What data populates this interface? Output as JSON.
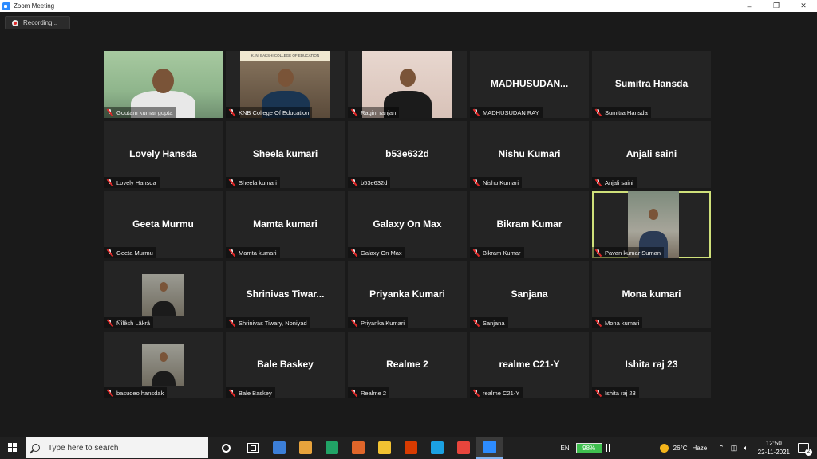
{
  "window": {
    "title": "Zoom Meeting",
    "minimize": "–",
    "maximize": "❐",
    "close": "✕"
  },
  "recording": {
    "label": "Recording..."
  },
  "participants": [
    {
      "big": "",
      "footer": "Goutam kumar gupta",
      "video": "v1"
    },
    {
      "big": "",
      "footer": "KNB College Of Education",
      "video": "v2",
      "banner": "K. N. BAKSHI COLLEGE OF EDUCATION"
    },
    {
      "big": "",
      "footer": "Ragini ranjan",
      "video": "v3"
    },
    {
      "big": "MADHUSUDAN...",
      "footer": "MADHUSUDAN RAY"
    },
    {
      "big": "Sumitra Hansda",
      "footer": "Sumitra Hansda"
    },
    {
      "big": "Lovely Hansda",
      "footer": "Lovely Hansda"
    },
    {
      "big": "Sheela kumari",
      "footer": "Sheela kumari"
    },
    {
      "big": "b53e632d",
      "footer": "b53e632d"
    },
    {
      "big": "Nishu Kumari",
      "footer": "Nishu Kumari"
    },
    {
      "big": "Anjali saini",
      "footer": "Anjali saini"
    },
    {
      "big": "Geeta Murmu",
      "footer": "Geeta Murmu"
    },
    {
      "big": "Mamta kumari",
      "footer": "Mamta kumari"
    },
    {
      "big": "Galaxy On Max",
      "footer": "Galaxy On Max"
    },
    {
      "big": "Bikram Kumar",
      "footer": "Bikram Kumar"
    },
    {
      "big": "",
      "footer": "Pavan kumar Suman",
      "video": "v4",
      "active": true
    },
    {
      "big": "",
      "footer": "Ñîlêsh Lâkrâ",
      "video": "v5"
    },
    {
      "big": "Shrinivas Tiwar...",
      "footer": "Shrinivas Tiwary, Noniyad"
    },
    {
      "big": "Priyanka Kumari",
      "footer": "Priyanka Kumari"
    },
    {
      "big": "Sanjana",
      "footer": "Sanjana"
    },
    {
      "big": "Mona kumari",
      "footer": "Mona kumari"
    },
    {
      "big": "",
      "footer": "basudeo hansdak",
      "video": "v5"
    },
    {
      "big": "Bale Baskey",
      "footer": "Bale Baskey"
    },
    {
      "big": "Realme 2",
      "footer": "Realme 2"
    },
    {
      "big": "realme C21-Y",
      "footer": "realme C21-Y"
    },
    {
      "big": "Ishita raj 23",
      "footer": "Ishita raj 23"
    }
  ],
  "taskbar": {
    "search_placeholder": "Type here to search",
    "apps": [
      {
        "name": "cortana-icon"
      },
      {
        "name": "task-view-icon"
      },
      {
        "name": "app-blue-icon",
        "color": "#3c7fd8"
      },
      {
        "name": "store-icon",
        "color": "#e8a33c"
      },
      {
        "name": "excel-icon",
        "color": "#21a366"
      },
      {
        "name": "app-orange-icon",
        "color": "#e0662a"
      },
      {
        "name": "file-explorer-icon",
        "color": "#f2c232"
      },
      {
        "name": "office-icon",
        "color": "#d83b01"
      },
      {
        "name": "edge-icon",
        "color": "#1ba1e2"
      },
      {
        "name": "chrome-icon",
        "color": "#e8453c"
      },
      {
        "name": "zoom-icon",
        "color": "#2d8cff"
      }
    ],
    "lang": "EN",
    "battery": "98%",
    "temperature": "26°C",
    "weather": "Haze",
    "time": "12:50",
    "date": "22-11-2021",
    "notifications": "2"
  }
}
